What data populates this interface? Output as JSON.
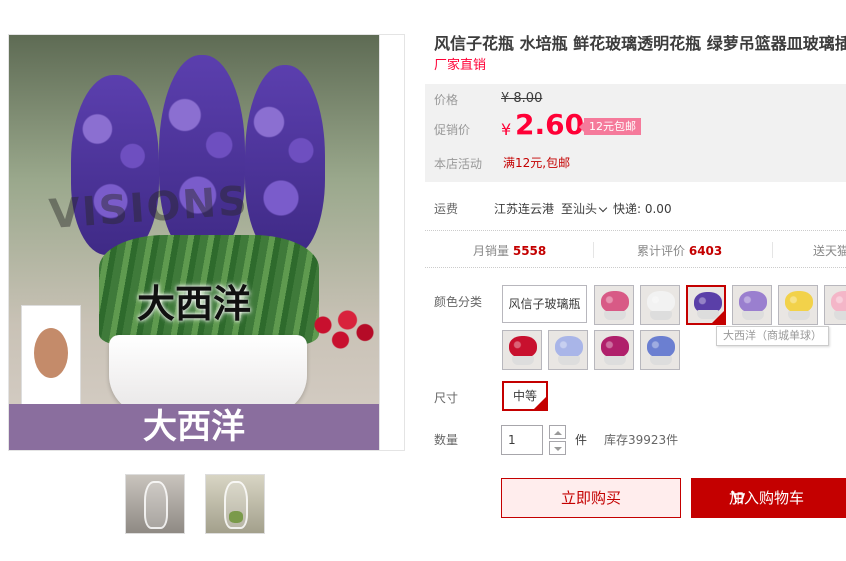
{
  "product": {
    "title": "风信子花瓶 水培瓶 鲜花玻璃透明花瓶 绿萝吊篮器皿玻璃插",
    "subtitle": "厂家直销",
    "image": {
      "watermark": "VISIONS",
      "caption": "大西洋",
      "banner": "大西洋"
    }
  },
  "price": {
    "orig_label": "价格",
    "orig_value": "¥ 8.00",
    "promo_label": "促销价",
    "currency": "¥",
    "current": "2.60",
    "tag": "12元包邮",
    "activity_label": "本店活动",
    "activity_value": "满12元,包邮"
  },
  "shipping": {
    "label": "运费",
    "from": "江苏连云港",
    "to": "至汕头",
    "fee": "快递: 0.00"
  },
  "stats": {
    "monthly_label": "月销量",
    "monthly_value": "5558",
    "reviews_label": "累计评价",
    "reviews_value": "6403",
    "extra_label": "送天猫"
  },
  "options": {
    "color_label": "颜色分类",
    "text_option": "风信子玻璃瓶",
    "swatch_colors": [
      "#d85a86",
      "#f2f2f2",
      "#5a3fa8",
      "#9a7fcf",
      "#f2d24a",
      "#f4b6c8",
      "#c8102e",
      "#a9b5e8",
      "#b0206b",
      "#6b7fd1"
    ],
    "tooltip": "大西洋（商城单球）",
    "size_label": "尺寸",
    "size_value": "中等",
    "qty_label": "数量",
    "qty_value": "1",
    "qty_unit": "件",
    "stock": "库存39923件"
  },
  "actions": {
    "buy": "立即购买",
    "cart": "加入购物车"
  }
}
